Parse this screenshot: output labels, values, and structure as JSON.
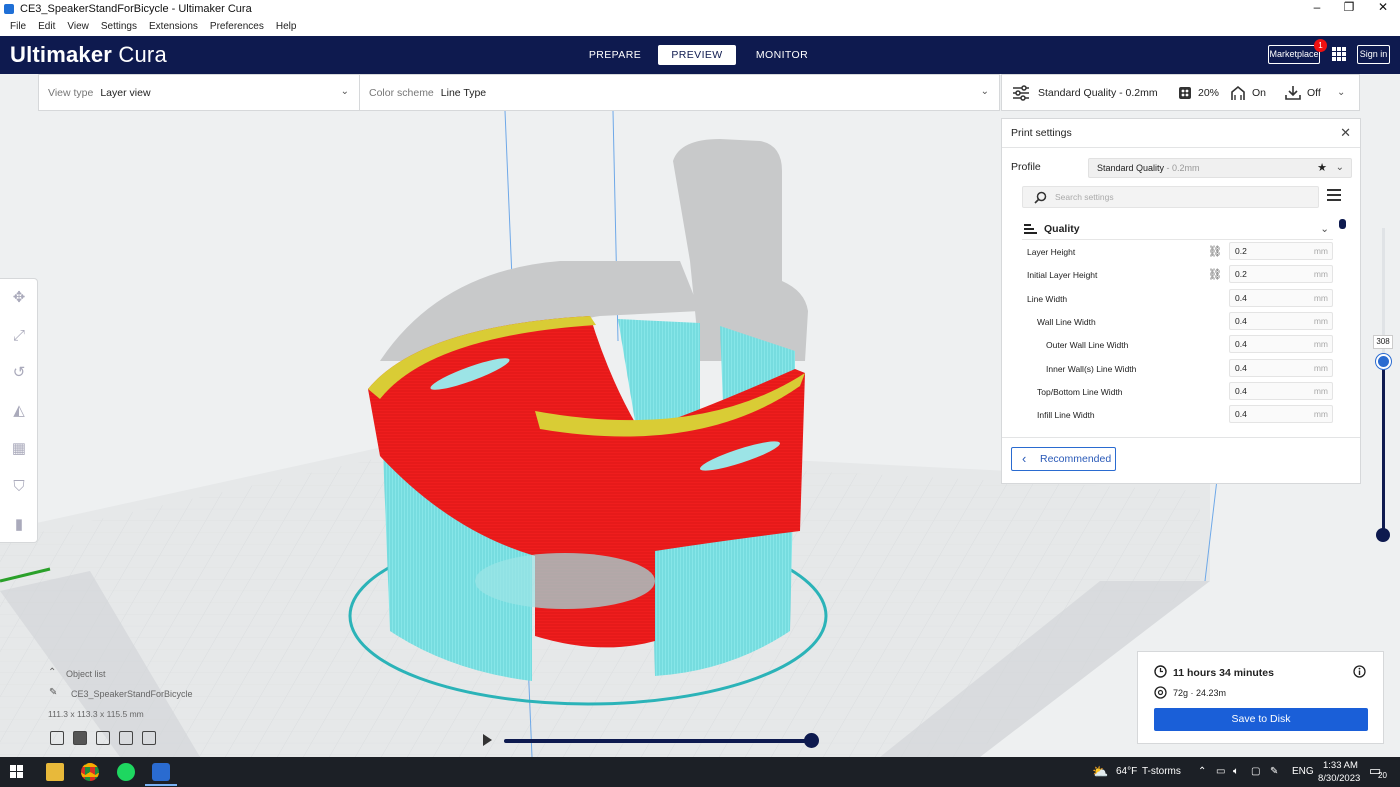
{
  "window": {
    "title": "CE3_SpeakerStandForBicycle - Ultimaker Cura"
  },
  "menubar": [
    "File",
    "Edit",
    "View",
    "Settings",
    "Extensions",
    "Preferences",
    "Help"
  ],
  "header": {
    "logo_bold": "Ultimaker",
    "logo_light": " Cura",
    "stages": [
      "PREPARE",
      "PREVIEW",
      "MONITOR"
    ],
    "marketplace": "Marketplace",
    "marketplace_badge": "1",
    "signin": "Sign in"
  },
  "viewbar": {
    "view_type_label": "View type",
    "view_type_value": "Layer view",
    "color_scheme_label": "Color scheme",
    "color_scheme_value": "Line Type"
  },
  "print_selector": {
    "profile": "Standard Quality - 0.2mm",
    "infill": "20%",
    "support": "On",
    "adhesion": "Off"
  },
  "print_settings": {
    "title": "Print settings",
    "profile_label": "Profile",
    "profile_name": "Standard Quality",
    "profile_suffix": " - 0.2mm",
    "search_placeholder": "Search settings",
    "category": "Quality",
    "rows": [
      {
        "label": "Layer Height",
        "value": "0.2",
        "unit": "mm",
        "linked": true,
        "indent": 0
      },
      {
        "label": "Initial Layer Height",
        "value": "0.2",
        "unit": "mm",
        "linked": true,
        "indent": 0
      },
      {
        "label": "Line Width",
        "value": "0.4",
        "unit": "mm",
        "linked": false,
        "indent": 0
      },
      {
        "label": "Wall Line Width",
        "value": "0.4",
        "unit": "mm",
        "linked": false,
        "indent": 1
      },
      {
        "label": "Outer Wall Line Width",
        "value": "0.4",
        "unit": "mm",
        "linked": false,
        "indent": 2
      },
      {
        "label": "Inner Wall(s) Line Width",
        "value": "0.4",
        "unit": "mm",
        "linked": false,
        "indent": 2
      },
      {
        "label": "Top/Bottom Line Width",
        "value": "0.4",
        "unit": "mm",
        "linked": false,
        "indent": 1
      },
      {
        "label": "Infill Line Width",
        "value": "0.4",
        "unit": "mm",
        "linked": false,
        "indent": 1
      }
    ],
    "recommended_button": "Recommended"
  },
  "layer_slider": {
    "current_layer": "308"
  },
  "job": {
    "time": "11 hours 34 minutes",
    "material": "72g · 24.23m",
    "save_button": "Save to Disk"
  },
  "object_list": {
    "title": "Object list",
    "object_name": "CE3_SpeakerStandForBicycle",
    "dimensions": "111.3 x 113.3 x 115.5 mm"
  },
  "taskbar": {
    "weather_temp": "64°F",
    "weather_desc": "T-storms",
    "language": "ENG",
    "time": "1:33 AM",
    "date": "8/30/2023",
    "notifications": "20"
  },
  "colors": {
    "header_bg": "#0e1a4f",
    "accent_blue": "#1a5fd8",
    "model_red": "#ee1c1c",
    "model_cyan": "#7fe3e6",
    "model_yellow": "#e3e01a",
    "support_cyan": "#2bb3b8"
  }
}
